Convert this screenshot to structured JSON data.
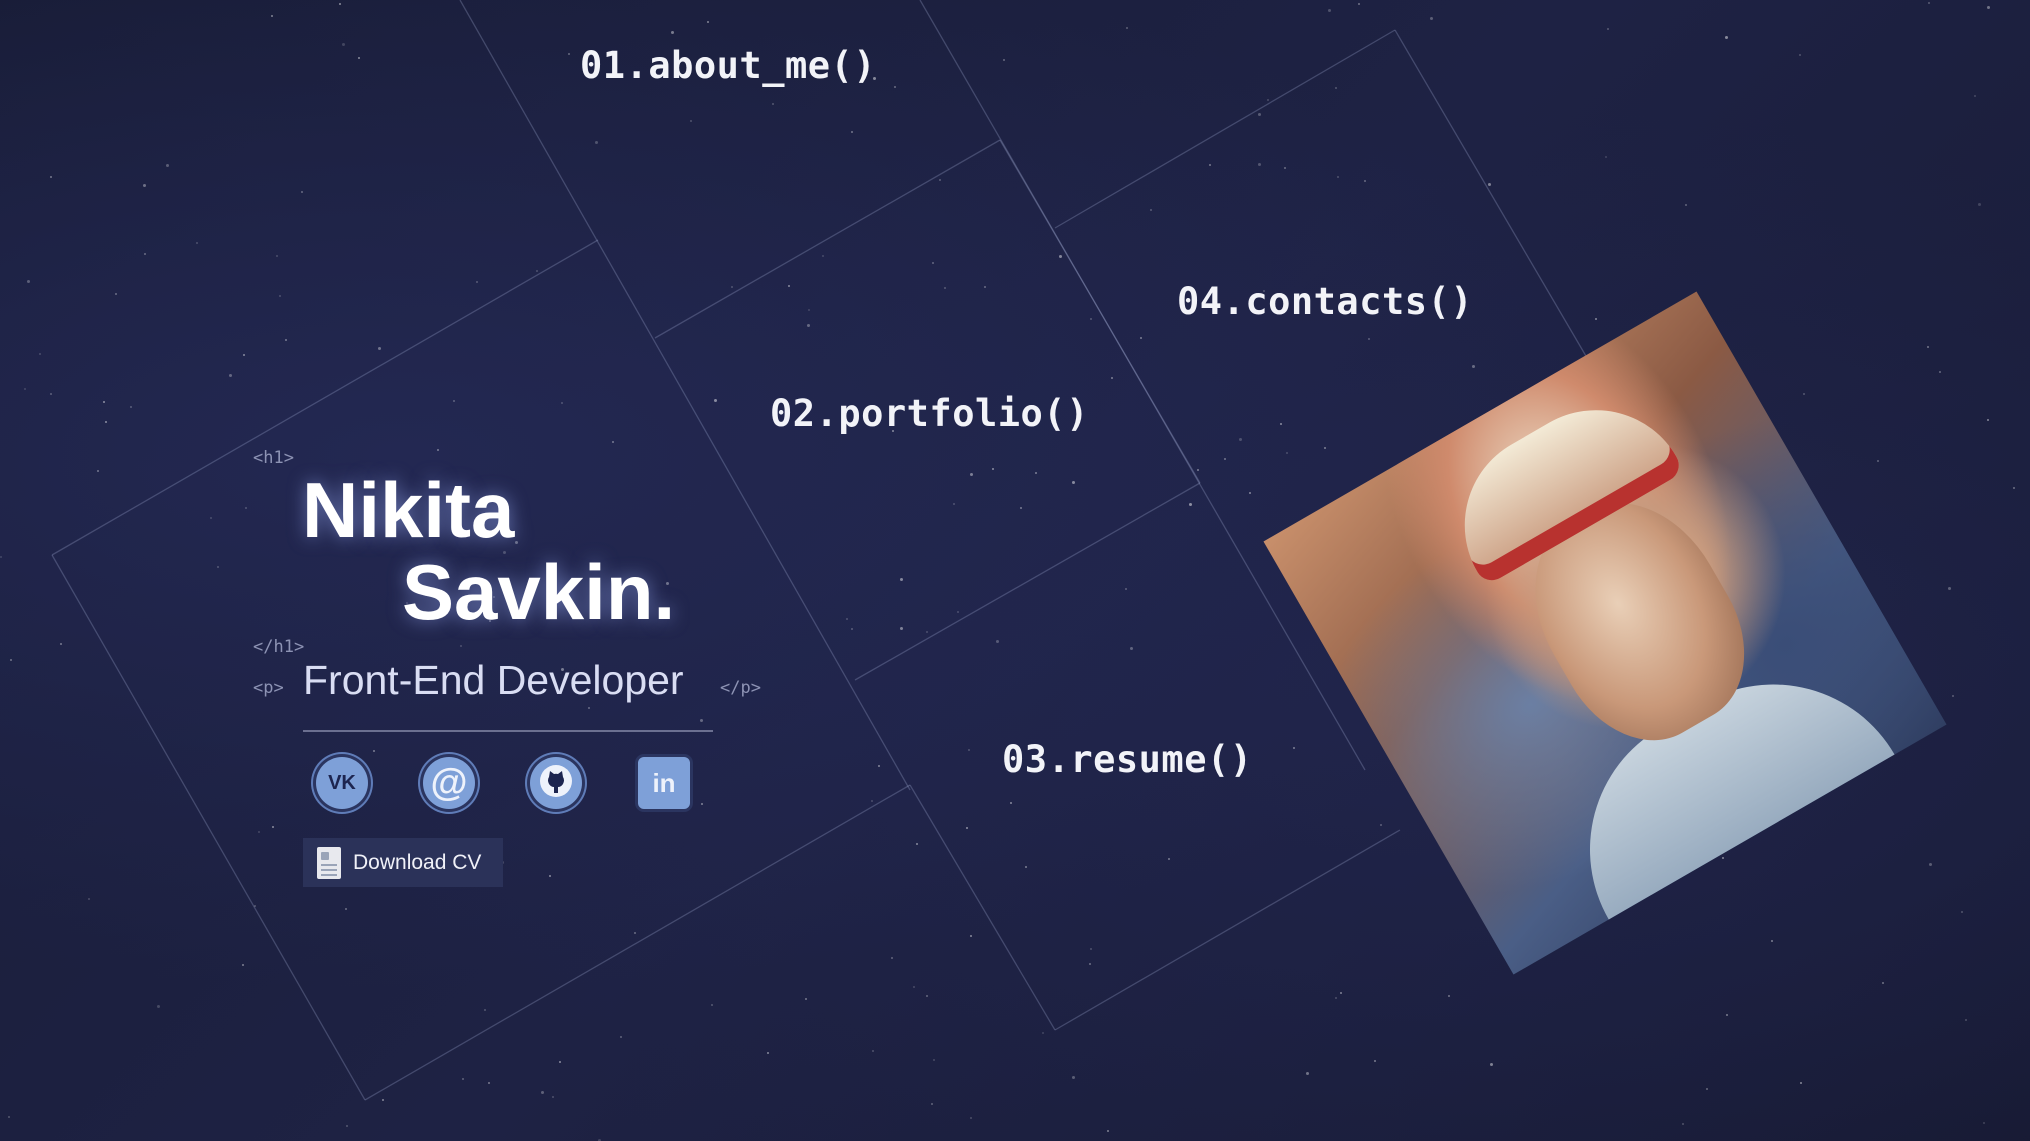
{
  "nav": {
    "about": "01.about_me()",
    "portfolio": "02.portfolio()",
    "resume": "03.resume()",
    "contacts": "04.contacts()"
  },
  "hero": {
    "tag_h1_open": "<h1>",
    "first_name": "Nikita",
    "last_name": "Savkin.",
    "tag_h1_close": "</h1>",
    "tag_p_open": "<p>",
    "subtitle": "Front-End Developer",
    "tag_p_close": "</p>"
  },
  "social": [
    {
      "name": "vk",
      "glyph": "VK",
      "icon": "vk-icon"
    },
    {
      "name": "mail",
      "glyph": "@",
      "icon": "at-sign-icon"
    },
    {
      "name": "github",
      "glyph": "",
      "icon": "github-icon"
    },
    {
      "name": "linkedin",
      "glyph": "in",
      "icon": "linkedin-icon"
    }
  ],
  "download_cv": {
    "label": "Download CV",
    "icon": "document-icon"
  },
  "portrait": {
    "icon": "profile-photo"
  },
  "colors": {
    "background": "#1b1f3a",
    "accent": "#7ea0d8",
    "text": "#ffffff",
    "tag": "#8d93b4"
  }
}
